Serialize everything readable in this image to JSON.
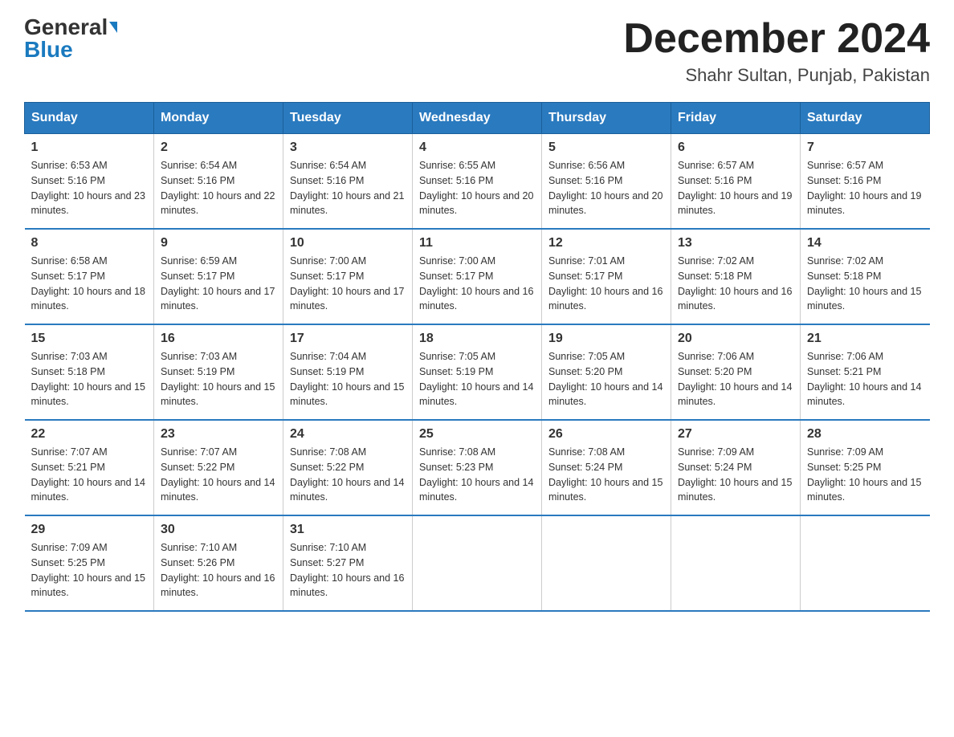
{
  "header": {
    "logo_general": "General",
    "logo_blue": "Blue",
    "month_title": "December 2024",
    "location": "Shahr Sultan, Punjab, Pakistan"
  },
  "days_of_week": [
    "Sunday",
    "Monday",
    "Tuesday",
    "Wednesday",
    "Thursday",
    "Friday",
    "Saturday"
  ],
  "weeks": [
    [
      {
        "day": "1",
        "sunrise": "6:53 AM",
        "sunset": "5:16 PM",
        "daylight": "10 hours and 23 minutes."
      },
      {
        "day": "2",
        "sunrise": "6:54 AM",
        "sunset": "5:16 PM",
        "daylight": "10 hours and 22 minutes."
      },
      {
        "day": "3",
        "sunrise": "6:54 AM",
        "sunset": "5:16 PM",
        "daylight": "10 hours and 21 minutes."
      },
      {
        "day": "4",
        "sunrise": "6:55 AM",
        "sunset": "5:16 PM",
        "daylight": "10 hours and 20 minutes."
      },
      {
        "day": "5",
        "sunrise": "6:56 AM",
        "sunset": "5:16 PM",
        "daylight": "10 hours and 20 minutes."
      },
      {
        "day": "6",
        "sunrise": "6:57 AM",
        "sunset": "5:16 PM",
        "daylight": "10 hours and 19 minutes."
      },
      {
        "day": "7",
        "sunrise": "6:57 AM",
        "sunset": "5:16 PM",
        "daylight": "10 hours and 19 minutes."
      }
    ],
    [
      {
        "day": "8",
        "sunrise": "6:58 AM",
        "sunset": "5:17 PM",
        "daylight": "10 hours and 18 minutes."
      },
      {
        "day": "9",
        "sunrise": "6:59 AM",
        "sunset": "5:17 PM",
        "daylight": "10 hours and 17 minutes."
      },
      {
        "day": "10",
        "sunrise": "7:00 AM",
        "sunset": "5:17 PM",
        "daylight": "10 hours and 17 minutes."
      },
      {
        "day": "11",
        "sunrise": "7:00 AM",
        "sunset": "5:17 PM",
        "daylight": "10 hours and 16 minutes."
      },
      {
        "day": "12",
        "sunrise": "7:01 AM",
        "sunset": "5:17 PM",
        "daylight": "10 hours and 16 minutes."
      },
      {
        "day": "13",
        "sunrise": "7:02 AM",
        "sunset": "5:18 PM",
        "daylight": "10 hours and 16 minutes."
      },
      {
        "day": "14",
        "sunrise": "7:02 AM",
        "sunset": "5:18 PM",
        "daylight": "10 hours and 15 minutes."
      }
    ],
    [
      {
        "day": "15",
        "sunrise": "7:03 AM",
        "sunset": "5:18 PM",
        "daylight": "10 hours and 15 minutes."
      },
      {
        "day": "16",
        "sunrise": "7:03 AM",
        "sunset": "5:19 PM",
        "daylight": "10 hours and 15 minutes."
      },
      {
        "day": "17",
        "sunrise": "7:04 AM",
        "sunset": "5:19 PM",
        "daylight": "10 hours and 15 minutes."
      },
      {
        "day": "18",
        "sunrise": "7:05 AM",
        "sunset": "5:19 PM",
        "daylight": "10 hours and 14 minutes."
      },
      {
        "day": "19",
        "sunrise": "7:05 AM",
        "sunset": "5:20 PM",
        "daylight": "10 hours and 14 minutes."
      },
      {
        "day": "20",
        "sunrise": "7:06 AM",
        "sunset": "5:20 PM",
        "daylight": "10 hours and 14 minutes."
      },
      {
        "day": "21",
        "sunrise": "7:06 AM",
        "sunset": "5:21 PM",
        "daylight": "10 hours and 14 minutes."
      }
    ],
    [
      {
        "day": "22",
        "sunrise": "7:07 AM",
        "sunset": "5:21 PM",
        "daylight": "10 hours and 14 minutes."
      },
      {
        "day": "23",
        "sunrise": "7:07 AM",
        "sunset": "5:22 PM",
        "daylight": "10 hours and 14 minutes."
      },
      {
        "day": "24",
        "sunrise": "7:08 AM",
        "sunset": "5:22 PM",
        "daylight": "10 hours and 14 minutes."
      },
      {
        "day": "25",
        "sunrise": "7:08 AM",
        "sunset": "5:23 PM",
        "daylight": "10 hours and 14 minutes."
      },
      {
        "day": "26",
        "sunrise": "7:08 AM",
        "sunset": "5:24 PM",
        "daylight": "10 hours and 15 minutes."
      },
      {
        "day": "27",
        "sunrise": "7:09 AM",
        "sunset": "5:24 PM",
        "daylight": "10 hours and 15 minutes."
      },
      {
        "day": "28",
        "sunrise": "7:09 AM",
        "sunset": "5:25 PM",
        "daylight": "10 hours and 15 minutes."
      }
    ],
    [
      {
        "day": "29",
        "sunrise": "7:09 AM",
        "sunset": "5:25 PM",
        "daylight": "10 hours and 15 minutes."
      },
      {
        "day": "30",
        "sunrise": "7:10 AM",
        "sunset": "5:26 PM",
        "daylight": "10 hours and 16 minutes."
      },
      {
        "day": "31",
        "sunrise": "7:10 AM",
        "sunset": "5:27 PM",
        "daylight": "10 hours and 16 minutes."
      },
      null,
      null,
      null,
      null
    ]
  ],
  "labels": {
    "sunrise": "Sunrise: ",
    "sunset": "Sunset: ",
    "daylight": "Daylight: "
  }
}
